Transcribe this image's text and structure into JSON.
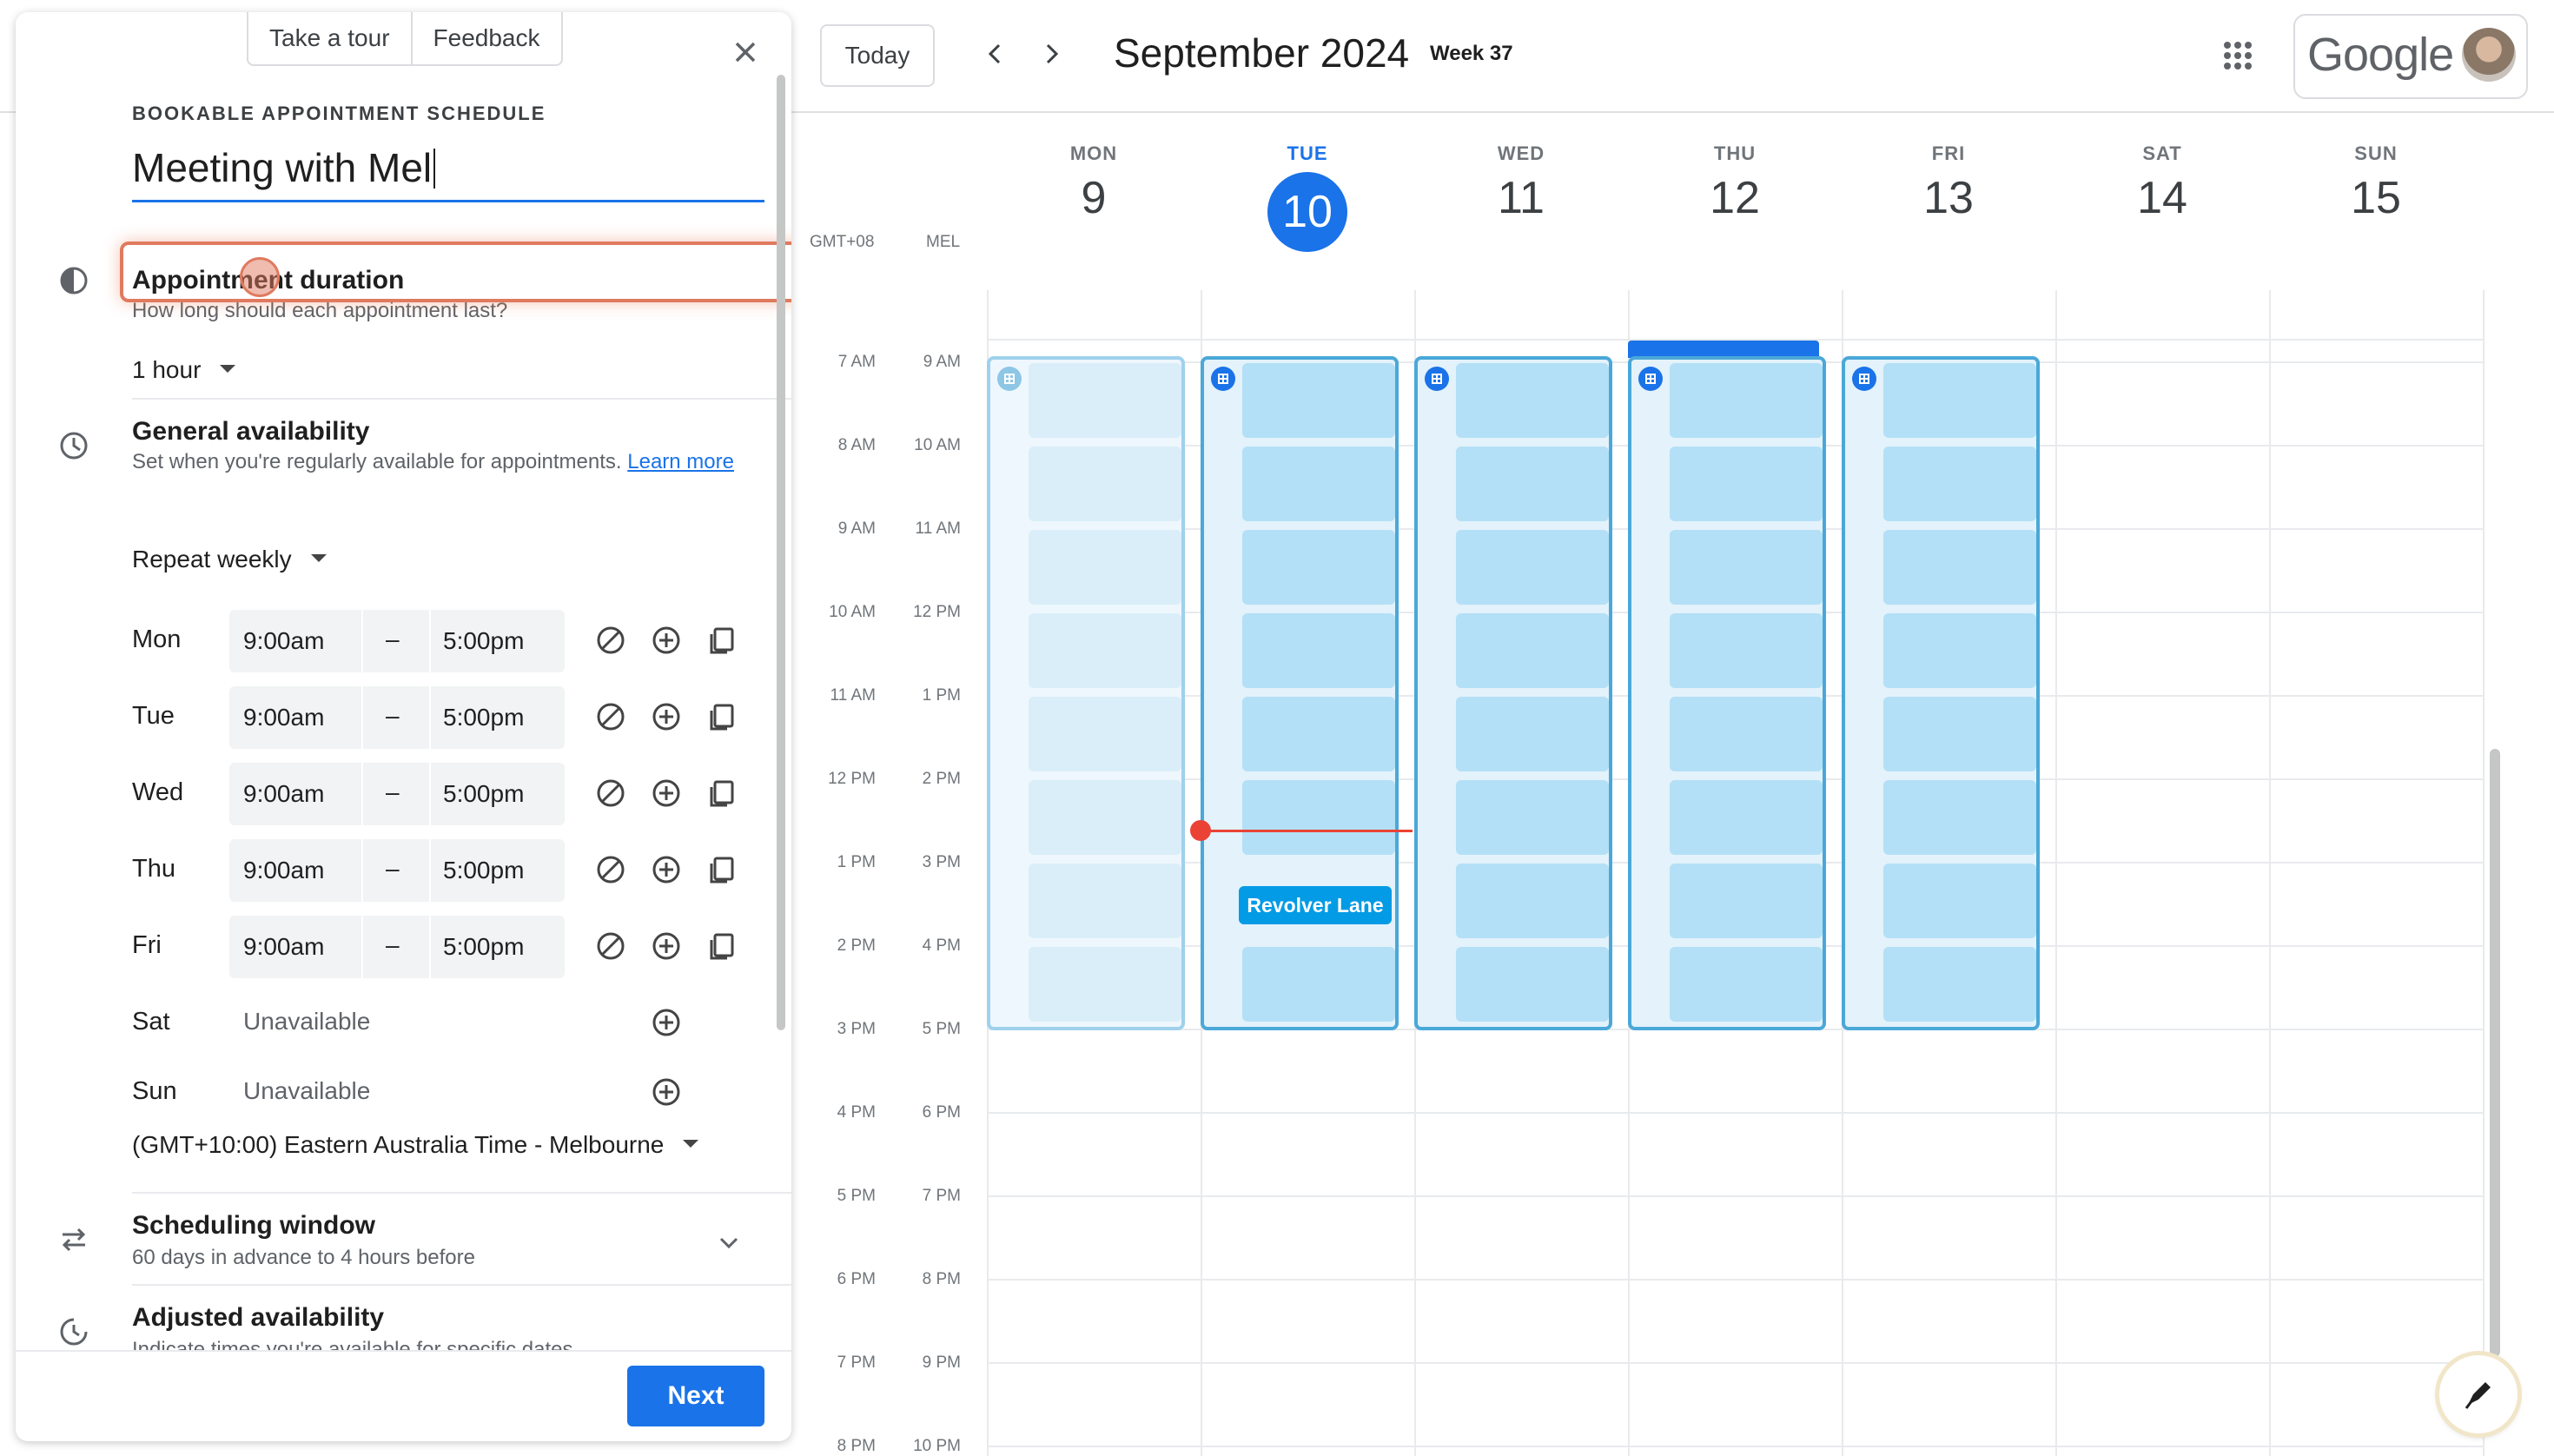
{
  "panel": {
    "take_tour": "Take a tour",
    "feedback": "Feedback",
    "section_caption": "BOOKABLE APPOINTMENT SCHEDULE",
    "title_value": "Meeting with Mel",
    "duration": {
      "title": "Appointment duration",
      "subtitle": "How long should each appointment last?",
      "value": "1 hour"
    },
    "availability": {
      "title": "General availability",
      "subtitle": "Set when you're regularly available for appointments.",
      "learn_more": "Learn more",
      "repeat": "Repeat weekly",
      "days": [
        {
          "day": "Mon",
          "start": "9:00am",
          "dash": "–",
          "end": "5:00pm"
        },
        {
          "day": "Tue",
          "start": "9:00am",
          "dash": "–",
          "end": "5:00pm"
        },
        {
          "day": "Wed",
          "start": "9:00am",
          "dash": "–",
          "end": "5:00pm"
        },
        {
          "day": "Thu",
          "start": "9:00am",
          "dash": "–",
          "end": "5:00pm"
        },
        {
          "day": "Fri",
          "start": "9:00am",
          "dash": "–",
          "end": "5:00pm"
        },
        {
          "day": "Sat",
          "unavailable": "Unavailable"
        },
        {
          "day": "Sun",
          "unavailable": "Unavailable"
        }
      ],
      "timezone": "(GMT+10:00) Eastern Australia Time - Melbourne"
    },
    "scheduling": {
      "title": "Scheduling window",
      "subtitle": "60 days in advance to 4 hours before"
    },
    "adjusted": {
      "title": "Adjusted availability",
      "subtitle": "Indicate times you're available for specific dates"
    },
    "next": "Next"
  },
  "toolbar": {
    "today": "Today",
    "month": "September 2024",
    "week": "Week 37",
    "brand": "Google"
  },
  "calendar": {
    "tz_primary": "GMT+08",
    "tz_secondary": "MEL",
    "days": [
      {
        "name": "MON",
        "num": "9"
      },
      {
        "name": "TUE",
        "num": "10"
      },
      {
        "name": "WED",
        "num": "11"
      },
      {
        "name": "THU",
        "num": "12"
      },
      {
        "name": "FRI",
        "num": "13"
      },
      {
        "name": "SAT",
        "num": "14"
      },
      {
        "name": "SUN",
        "num": "15"
      }
    ],
    "hours_primary": [
      "7 AM",
      "8 AM",
      "9 AM",
      "10 AM",
      "11 AM",
      "12 PM",
      "1 PM",
      "2 PM",
      "3 PM",
      "4 PM",
      "5 PM",
      "6 PM",
      "7 PM",
      "8 PM"
    ],
    "hours_secondary": [
      "9 AM",
      "10 AM",
      "11 AM",
      "12 PM",
      "1 PM",
      "2 PM",
      "3 PM",
      "4 PM",
      "5 PM",
      "6 PM",
      "7 PM",
      "8 PM",
      "9 PM",
      "10 PM"
    ],
    "event": "Revolver Lane",
    "today_index": 1
  },
  "colors": {
    "accent": "#1a73e8",
    "highlight": "#e07a5f",
    "slot": "#b3e0f6",
    "now": "#ea4335"
  }
}
